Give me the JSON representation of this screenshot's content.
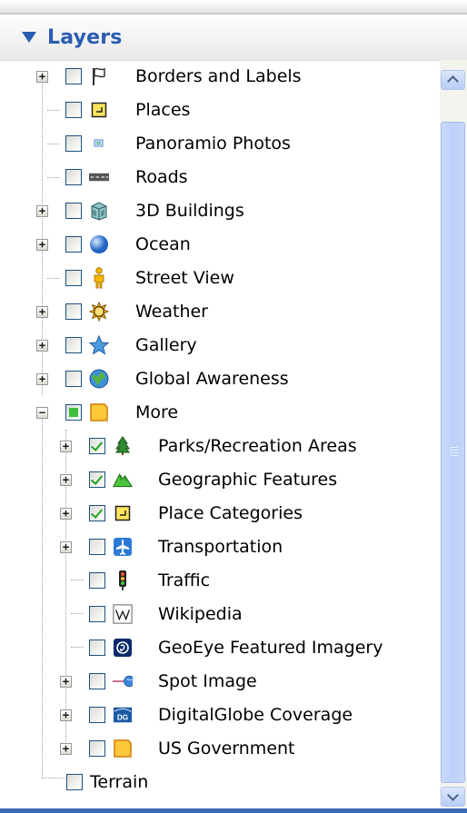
{
  "panel": {
    "title": "Layers"
  },
  "layers": [
    {
      "label": "Borders and Labels",
      "icon": "flag-icon",
      "checkbox": "unchecked",
      "expandable": true,
      "expanded": false
    },
    {
      "label": "Places",
      "icon": "place-marker-icon",
      "checkbox": "unchecked",
      "expandable": false
    },
    {
      "label": "Panoramio Photos",
      "icon": "photo-icon",
      "checkbox": "unchecked",
      "expandable": false
    },
    {
      "label": "Roads",
      "icon": "road-icon",
      "checkbox": "unchecked",
      "expandable": false
    },
    {
      "label": "3D Buildings",
      "icon": "building-icon",
      "checkbox": "unchecked",
      "expandable": true,
      "expanded": false
    },
    {
      "label": "Ocean",
      "icon": "globe-ocean-icon",
      "checkbox": "unchecked",
      "expandable": true,
      "expanded": false
    },
    {
      "label": "Street View",
      "icon": "pegman-icon",
      "checkbox": "unchecked",
      "expandable": false
    },
    {
      "label": "Weather",
      "icon": "sun-icon",
      "checkbox": "unchecked",
      "expandable": true,
      "expanded": false
    },
    {
      "label": "Gallery",
      "icon": "star-icon",
      "checkbox": "unchecked",
      "expandable": true,
      "expanded": false
    },
    {
      "label": "Global Awareness",
      "icon": "globe-icon",
      "checkbox": "unchecked",
      "expandable": true,
      "expanded": false
    },
    {
      "label": "More",
      "icon": "folder-icon",
      "checkbox": "partial",
      "expandable": true,
      "expanded": true
    },
    {
      "label": "Parks/Recreation Areas",
      "icon": "tree-icon",
      "checkbox": "checked",
      "expandable": true,
      "expanded": false
    },
    {
      "label": "Geographic Features",
      "icon": "mountain-icon",
      "checkbox": "checked",
      "expandable": true,
      "expanded": false
    },
    {
      "label": "Place Categories",
      "icon": "place-marker-icon",
      "checkbox": "checked",
      "expandable": true,
      "expanded": false
    },
    {
      "label": "Transportation",
      "icon": "airplane-icon",
      "checkbox": "unchecked",
      "expandable": true,
      "expanded": false
    },
    {
      "label": "Traffic",
      "icon": "traffic-light-icon",
      "checkbox": "unchecked",
      "expandable": false
    },
    {
      "label": "Wikipedia",
      "icon": "wikipedia-icon",
      "checkbox": "unchecked",
      "expandable": false
    },
    {
      "label": "GeoEye Featured Imagery",
      "icon": "geoeye-icon",
      "checkbox": "unchecked",
      "expandable": false
    },
    {
      "label": "Spot Image",
      "icon": "spot-image-icon",
      "checkbox": "unchecked",
      "expandable": true,
      "expanded": false
    },
    {
      "label": "DigitalGlobe Coverage",
      "icon": "digitalglobe-icon",
      "checkbox": "unchecked",
      "expandable": true,
      "expanded": false
    },
    {
      "label": "US Government",
      "icon": "folder-icon",
      "checkbox": "unchecked",
      "expandable": true,
      "expanded": false
    },
    {
      "label": "Terrain",
      "icon": "",
      "checkbox": "unchecked",
      "expandable": false
    }
  ],
  "scrollbar": {
    "position": 0.0
  }
}
